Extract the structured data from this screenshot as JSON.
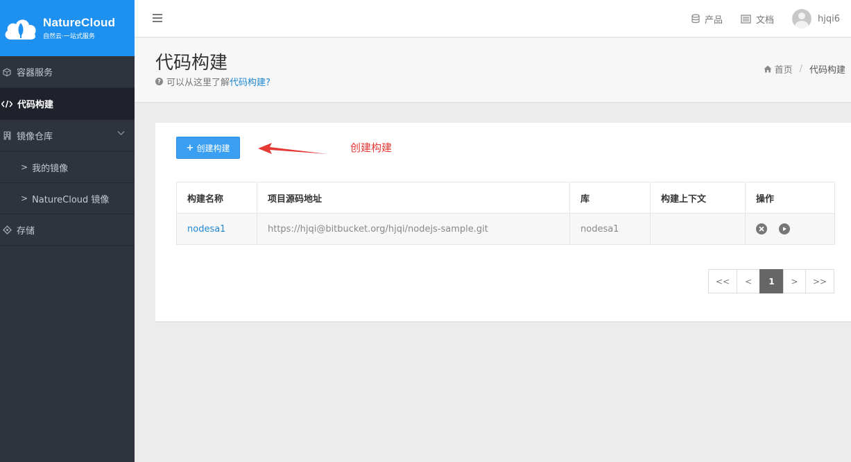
{
  "brand": {
    "name": "NatureCloud",
    "tagline": "自然云·一站式服务",
    "color": "#1e90ef"
  },
  "sidebar": {
    "items": [
      {
        "label": "容器服务",
        "icon": "cube-icon"
      },
      {
        "label": "代码构建",
        "icon": "code-icon",
        "active": true
      },
      {
        "label": "镜像仓库",
        "icon": "building-icon",
        "expanded": true
      },
      {
        "label": "我的镜像",
        "sub": true
      },
      {
        "label": "NatureCloud 镜像",
        "sub": true
      },
      {
        "label": "存储",
        "icon": "puzzle-icon"
      }
    ]
  },
  "header": {
    "products": "产品",
    "docs": "文档",
    "username": "hjqi6"
  },
  "page": {
    "title": "代码构建",
    "hint_prefix": "可以从这里了解",
    "hint_link": "代码构建?",
    "breadcrumb": {
      "home": "首页",
      "current": "代码构建"
    }
  },
  "toolbar": {
    "create_label": "创建构建"
  },
  "annotation": {
    "text": "创建构建",
    "color": "#e53935"
  },
  "table": {
    "headers": [
      "构建名称",
      "项目源码地址",
      "库",
      "构建上下文",
      "操作"
    ],
    "rows": [
      {
        "name": "nodesa1",
        "repo_url": "https://hjqi@bitbucket.org/hjqi/nodejs-sample.git",
        "library": "nodesa1",
        "context": ""
      }
    ]
  },
  "pagination": {
    "first": "<<",
    "prev": "<",
    "current": "1",
    "next": ">",
    "last": ">>"
  }
}
